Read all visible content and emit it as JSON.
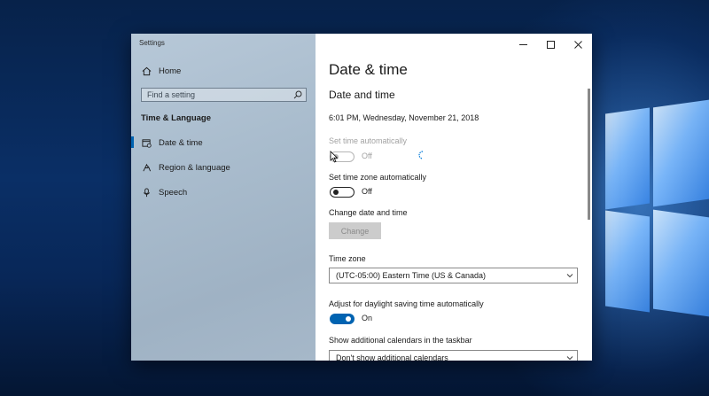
{
  "window": {
    "title": "Settings"
  },
  "sidebar": {
    "home": "Home",
    "search_placeholder": "Find a setting",
    "section": "Time & Language",
    "items": [
      {
        "label": "Date & time",
        "icon": "calendar-clock-icon",
        "active": true
      },
      {
        "label": "Region & language",
        "icon": "region-language-icon",
        "active": false
      },
      {
        "label": "Speech",
        "icon": "microphone-icon",
        "active": false
      }
    ]
  },
  "content": {
    "page_title": "Date & time",
    "section_title": "Date and time",
    "current_datetime": "6:01 PM, Wednesday, November 21, 2018",
    "set_time_auto": {
      "label": "Set time automatically",
      "state": "Off",
      "enabled": false
    },
    "set_timezone_auto": {
      "label": "Set time zone automatically",
      "state": "Off"
    },
    "change_date_time": {
      "label": "Change date and time",
      "button": "Change"
    },
    "time_zone": {
      "label": "Time zone",
      "value": "(UTC-05:00) Eastern Time (US & Canada)"
    },
    "daylight_saving": {
      "label": "Adjust for daylight saving time automatically",
      "state": "On"
    },
    "additional_calendars": {
      "label": "Show additional calendars in the taskbar",
      "value": "Don't show additional calendars"
    }
  },
  "colors": {
    "accent": "#0063b1",
    "sidebar_bg": "#a9bccd"
  }
}
